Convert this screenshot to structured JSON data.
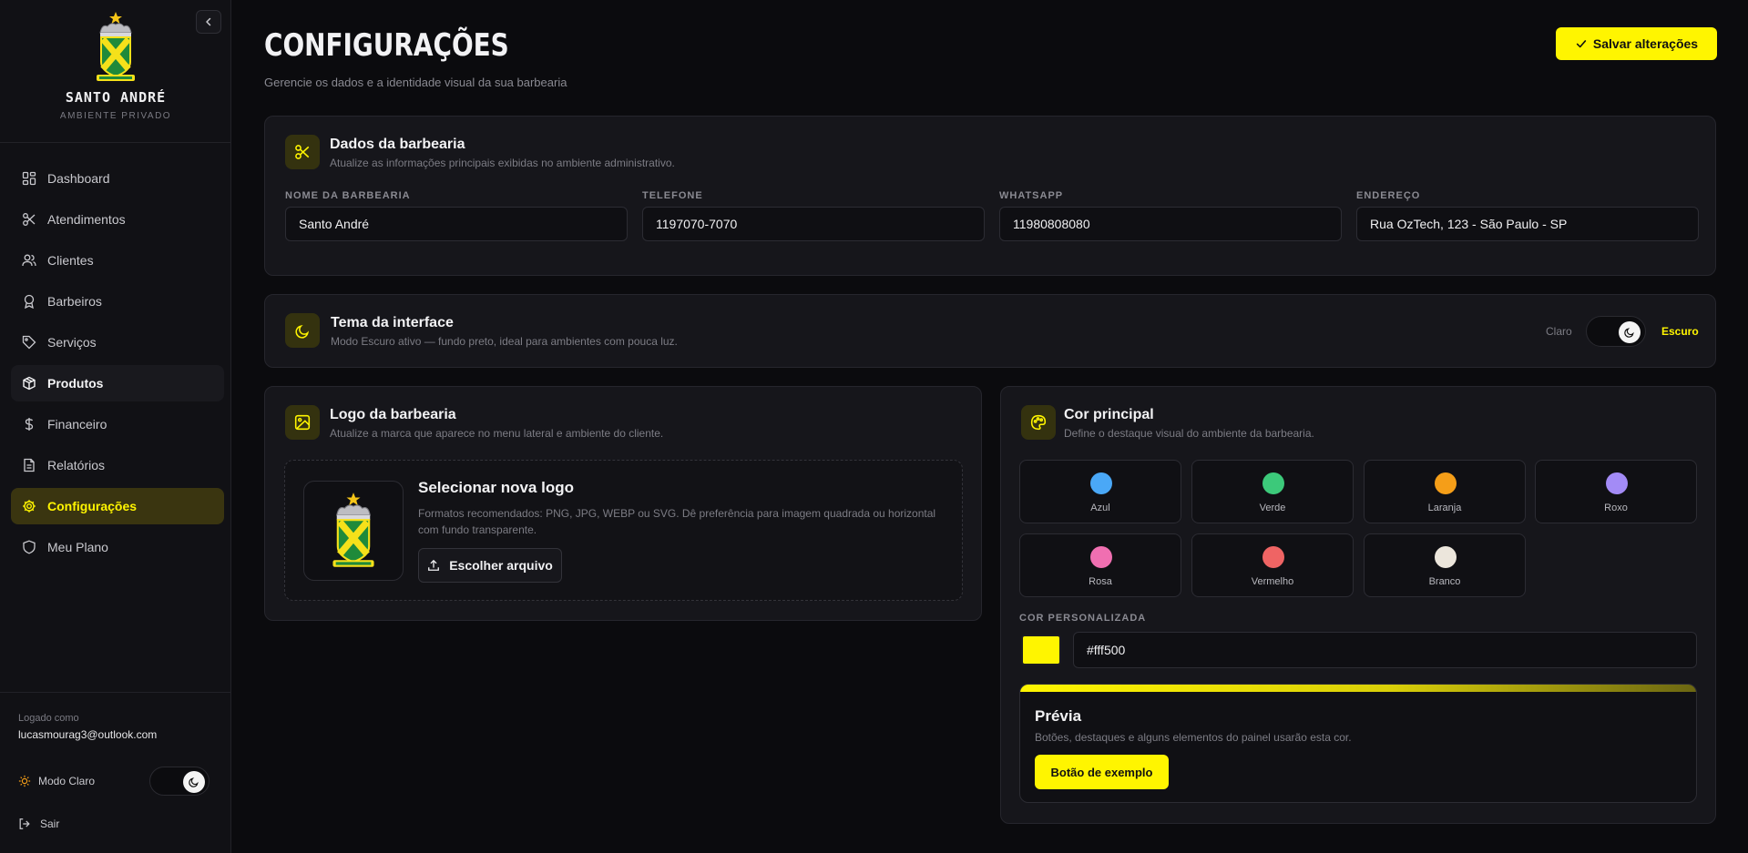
{
  "sidebar": {
    "brand_name": "SANTO ANDRÉ",
    "brand_subtitle": "AMBIENTE PRIVADO",
    "items": [
      {
        "label": "Dashboard",
        "icon": "dashboard-icon"
      },
      {
        "label": "Atendimentos",
        "icon": "scissors-icon"
      },
      {
        "label": "Clientes",
        "icon": "users-icon"
      },
      {
        "label": "Barbeiros",
        "icon": "award-icon"
      },
      {
        "label": "Serviços",
        "icon": "tag-icon"
      },
      {
        "label": "Produtos",
        "icon": "package-icon"
      },
      {
        "label": "Financeiro",
        "icon": "dollar-icon"
      },
      {
        "label": "Relatórios",
        "icon": "file-icon"
      },
      {
        "label": "Configurações",
        "icon": "gear-icon"
      },
      {
        "label": "Meu Plano",
        "icon": "shield-icon"
      }
    ],
    "active_item": "Configurações",
    "logged_label": "Logado como",
    "logged_email": "lucasmourag3@outlook.com",
    "mode_label": "Modo Claro",
    "logout_label": "Sair"
  },
  "header": {
    "title": "CONFIGURAÇÕES",
    "subtitle": "Gerencie os dados e a identidade visual da sua barbearia",
    "save_label": "Salvar alterações"
  },
  "dados": {
    "title": "Dados da barbearia",
    "description": "Atualize as informações principais exibidas no ambiente administrativo.",
    "fields": [
      {
        "label": "NOME DA BARBEARIA",
        "value": "Santo André"
      },
      {
        "label": "TELEFONE",
        "value": "1197070-7070"
      },
      {
        "label": "WHATSAPP",
        "value": "11980808080"
      },
      {
        "label": "ENDEREÇO",
        "value": "Rua OzTech, 123 - São Paulo - SP"
      }
    ]
  },
  "tema": {
    "title": "Tema da interface",
    "description": "Modo Escuro ativo — fundo preto, ideal para ambientes com pouca luz.",
    "light_label": "Claro",
    "dark_label": "Escuro",
    "selected": "Escuro"
  },
  "logo": {
    "title": "Logo da barbearia",
    "description": "Atualize a marca que aparece no menu lateral e ambiente do cliente.",
    "select_title": "Selecionar nova logo",
    "formats_text": "Formatos recomendados: PNG, JPG, WEBP ou SVG. Dê preferência para imagem quadrada ou horizontal com fundo transparente.",
    "choose_label": "Escolher arquivo"
  },
  "cor": {
    "title": "Cor principal",
    "description": "Define o destaque visual do ambiente da barbearia.",
    "swatches": [
      {
        "name": "Azul",
        "color": "#4aa8f7"
      },
      {
        "name": "Verde",
        "color": "#3cc97a"
      },
      {
        "name": "Laranja",
        "color": "#f59e18"
      },
      {
        "name": "Roxo",
        "color": "#a38bf6"
      },
      {
        "name": "Rosa",
        "color": "#f06fb1"
      },
      {
        "name": "Vermelho",
        "color": "#ef6464"
      },
      {
        "name": "Branco",
        "color": "#ece6dc"
      }
    ],
    "custom_label": "COR PERSONALIZADA",
    "custom_value": "#fff500",
    "preview_title": "Prévia",
    "preview_text": "Botões, destaques e alguns elementos do painel usarão esta cor.",
    "sample_button": "Botão de exemplo"
  },
  "colors": {
    "accent": "#fff500",
    "background": "#0b0b0e",
    "card": "#16161b"
  }
}
